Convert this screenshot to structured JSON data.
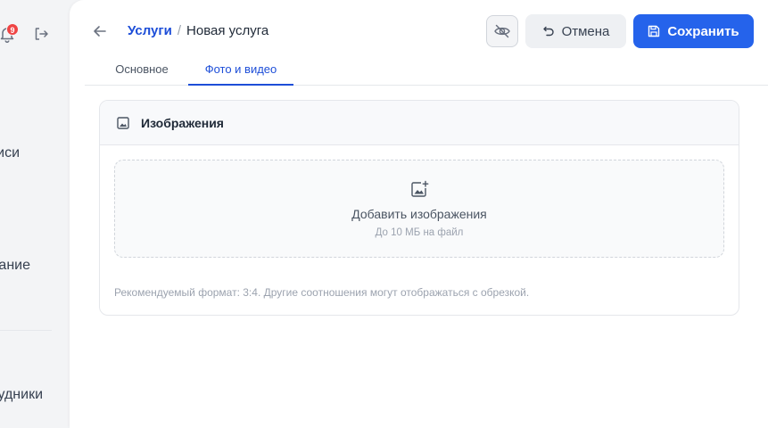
{
  "sidebar": {
    "notifications_count": "9",
    "items": [
      {
        "label": "иси"
      },
      {
        "label": "ание"
      },
      {
        "label": "удники"
      }
    ]
  },
  "header": {
    "breadcrumb_parent": "Услуги",
    "breadcrumb_separator": "/",
    "breadcrumb_current": "Новая услуга",
    "cancel_label": "Отмена",
    "save_label": "Сохранить"
  },
  "tabs": [
    {
      "label": "Основное",
      "active": false
    },
    {
      "label": "Фото и видео",
      "active": true
    }
  ],
  "images_card": {
    "title": "Изображения",
    "dropzone_title": "Добавить изображения",
    "dropzone_subtitle": "До 10 МБ на файл",
    "hint": "Рекомендуемый формат: 3:4. Другие соотношения могут отображаться с обрезкой."
  },
  "colors": {
    "accent": "#2563eb",
    "link": "#1d4ed8",
    "badge": "#ef4444"
  }
}
